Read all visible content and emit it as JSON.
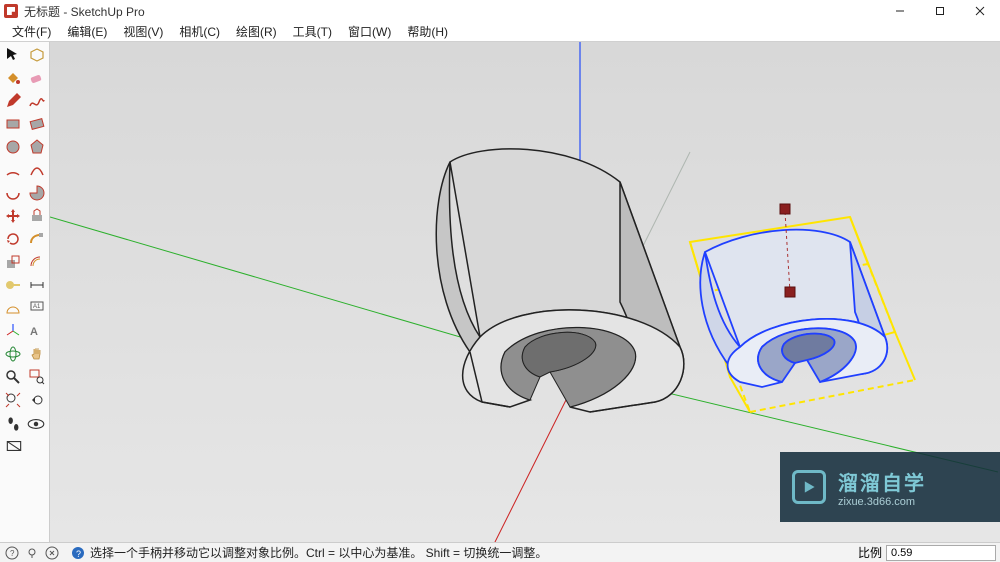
{
  "title": "无标题 - SketchUp Pro",
  "menu": [
    "文件(F)",
    "编辑(E)",
    "视图(V)",
    "相机(C)",
    "绘图(R)",
    "工具(T)",
    "窗口(W)",
    "帮助(H)"
  ],
  "status": {
    "hint": "选择一个手柄并移动它以调整对象比例。Ctrl = 以中心为基准。 Shift = 切换统一调整。",
    "measure_label": "比例",
    "measure_value": "0.59"
  },
  "colors": {
    "axis_blue": "#0030ff",
    "axis_red": "#cc2020",
    "axis_green": "#2cb02c",
    "sel_yellow": "#ffe500",
    "sel_blue": "#2040ff"
  },
  "watermark": {
    "main": "溜溜自学",
    "sub": "zixue.3d66.com"
  }
}
